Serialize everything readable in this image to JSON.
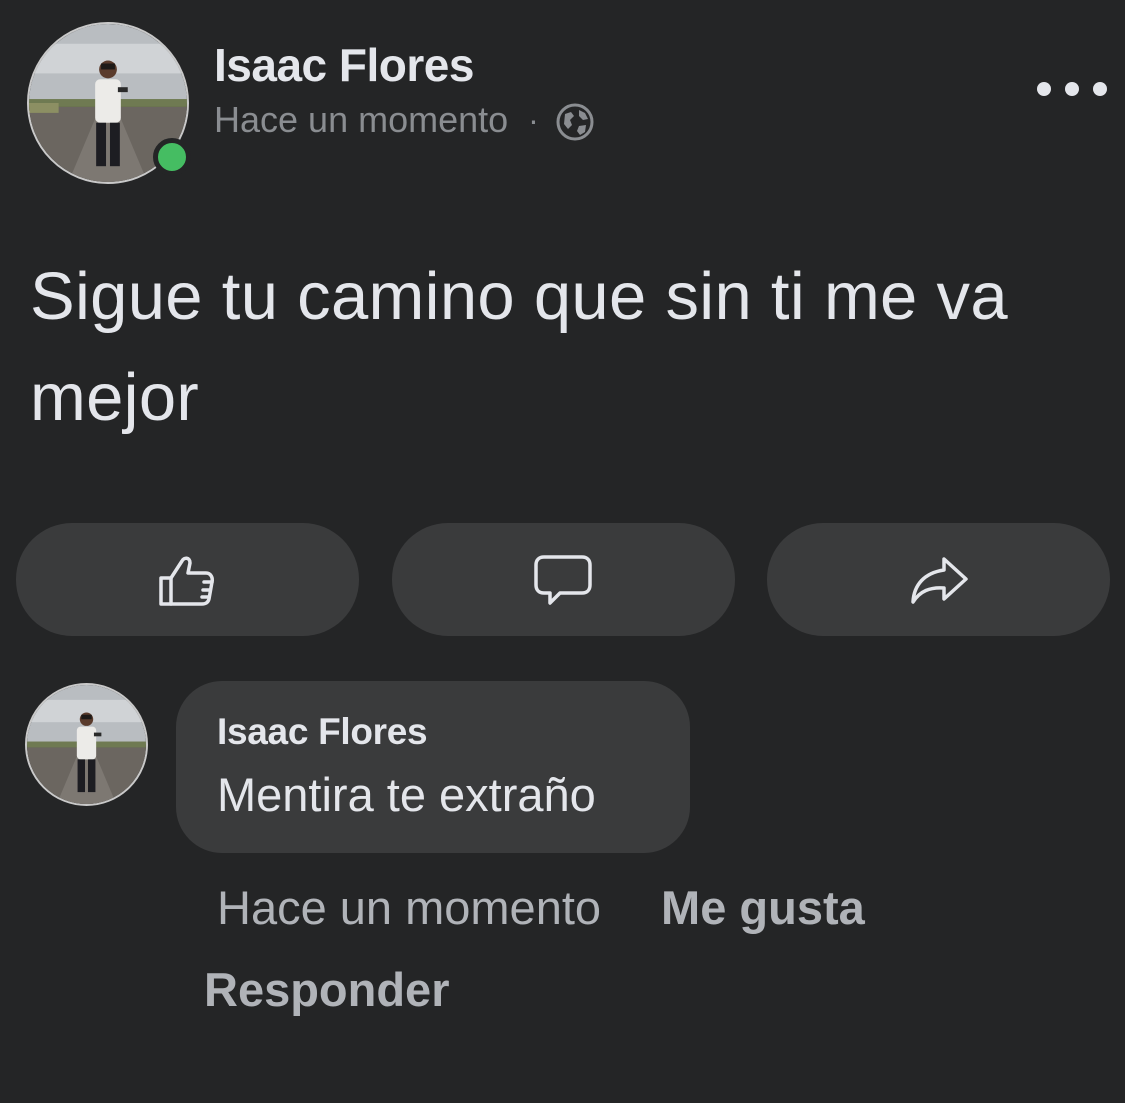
{
  "post": {
    "author": "Isaac Flores",
    "timestamp": "Hace un momento",
    "separator": "·",
    "audience_icon": "globe-icon",
    "online": true,
    "text": "Sigue tu camino que sin ti me va mejor"
  },
  "actions": [
    {
      "name": "like",
      "icon": "thumbs-up-icon"
    },
    {
      "name": "comment",
      "icon": "comment-icon"
    },
    {
      "name": "share",
      "icon": "share-icon"
    }
  ],
  "comment": {
    "author": "Isaac Flores",
    "text": "Mentira te extraño",
    "timestamp": "Hace un momento",
    "like_label": "Me gusta",
    "reply_label": "Responder"
  },
  "colors": {
    "background": "#242526",
    "surface": "#3a3b3c",
    "primary_text": "#e4e6eb",
    "secondary_text": "#b0b3b8",
    "online_indicator": "#45bd62"
  }
}
